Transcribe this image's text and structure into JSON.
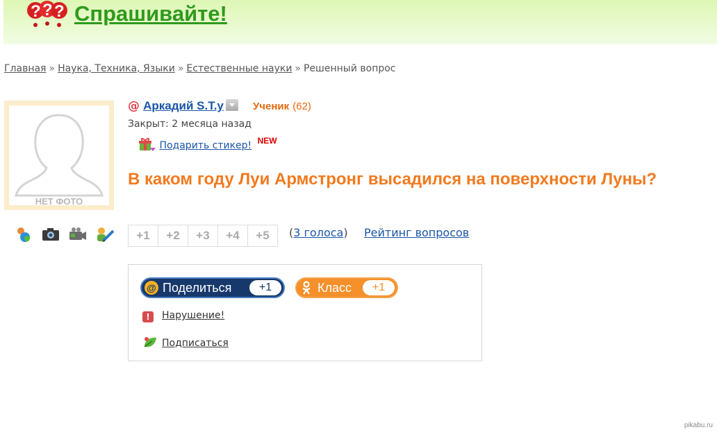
{
  "header": {
    "logo_text": "Спрашивайте!",
    "logo_icon": "question-marks-icon"
  },
  "breadcrumb": {
    "items": [
      "Главная",
      "Наука, Техника, Языки",
      "Естественные науки"
    ],
    "separator": "»",
    "current": "Решенный вопрос"
  },
  "avatar": {
    "label": "НЕТ ФОТО"
  },
  "user": {
    "at_symbol": "@",
    "name": "Аркадий S.T.y",
    "rank": "Ученик",
    "points": "(62)",
    "closed": "Закрыт: 2 месяца назад",
    "sticker_link": "Подарить стикер!",
    "new_badge": "NEW"
  },
  "question": {
    "title": "В каком году Луи Армстронг высадился на поверхности Луны?"
  },
  "votes": {
    "buttons": [
      "+1",
      "+2",
      "+3",
      "+4",
      "+5"
    ],
    "open_paren": "(",
    "count_link": "3 голоса",
    "close_paren": ")",
    "rating_link": "Рейтинг вопросов"
  },
  "share": {
    "mail_label": "Поделиться",
    "mail_count": "+1",
    "ok_label": "Класс",
    "ok_count": "+1",
    "violation": "Нарушение!",
    "subscribe": "Подписаться"
  },
  "watermark": "pikabu.ru",
  "colors": {
    "accent_orange": "#f27a1e",
    "link_blue": "#1a55a8",
    "logo_green": "#2f9a1c",
    "mail_pill": "#17386b",
    "ok_pill": "#f5902a"
  }
}
